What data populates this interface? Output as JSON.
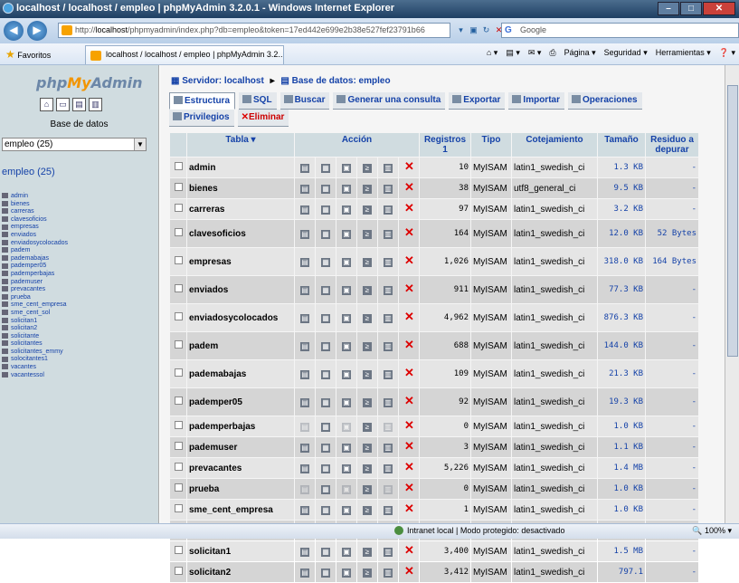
{
  "window": {
    "title": "localhost / localhost / empleo | phpMyAdmin 3.2.0.1 - Windows Internet Explorer"
  },
  "browser": {
    "url_prefix": "http://",
    "url_host": "localhost",
    "url_rest": "/phpmyadmin/index.php?db=empleo&token=17ed442e699e2b38e527fef23791b66",
    "search_placeholder": "Google",
    "favorites_label": "Favoritos",
    "tab_title": "localhost / localhost / empleo | phpMyAdmin 3.2...",
    "commands": [
      "Página ▾",
      "Seguridad ▾",
      "Herramientas ▾"
    ],
    "status_zone": "Intranet local | Modo protegido: desactivado",
    "zoom": "100%"
  },
  "left": {
    "logo_php": "php",
    "logo_my": "My",
    "logo_admin": "Admin",
    "db_label": "Base de datos",
    "db_select": "empleo (25)",
    "db_name": "empleo",
    "db_count": " (25)",
    "tables": [
      "admin",
      "bienes",
      "carreras",
      "clavesoficios",
      "empresas",
      "enviados",
      "enviadosycolocados",
      "padem",
      "pademabajas",
      "pademper05",
      "pademperbajas",
      "pademuser",
      "prevacantes",
      "prueba",
      "sme_cent_empresa",
      "sme_cent_sol",
      "solicitan1",
      "solicitan2",
      "solicitante",
      "solicitantes",
      "solicitantes_emmy",
      "solocitantes1",
      "vacantes",
      "vacantessol"
    ]
  },
  "breadcrumb": {
    "server": "Servidor: localhost",
    "db": "Base de datos: empleo"
  },
  "tabs": {
    "row1": [
      "Estructura",
      "SQL",
      "Buscar",
      "Generar una consulta",
      "Exportar",
      "Importar",
      "Operaciones"
    ],
    "row2": [
      "Privilegios",
      "Eliminar"
    ]
  },
  "table": {
    "headers": {
      "tabla": "Tabla ▾",
      "accion": "Acción",
      "registros": "Registros",
      "registros_sub": "1",
      "tipo": "Tipo",
      "cotejamiento": "Cotejamiento",
      "tamano": "Tamaño",
      "residuo": "Residuo a depurar"
    },
    "rows": [
      {
        "name": "admin",
        "records": "10",
        "type": "MyISAM",
        "collation": "latin1_swedish_ci",
        "size": "1.3 KB",
        "overhead": "-"
      },
      {
        "name": "bienes",
        "records": "38",
        "type": "MyISAM",
        "collation": "utf8_general_ci",
        "size": "9.5 KB",
        "overhead": "-"
      },
      {
        "name": "carreras",
        "records": "97",
        "type": "MyISAM",
        "collation": "latin1_swedish_ci",
        "size": "3.2 KB",
        "overhead": "-"
      },
      {
        "name": "clavesoficios",
        "records": "164",
        "type": "MyISAM",
        "collation": "latin1_swedish_ci",
        "size": "12.0 KB",
        "overhead": "52 Bytes"
      },
      {
        "name": "empresas",
        "records": "1,026",
        "type": "MyISAM",
        "collation": "latin1_swedish_ci",
        "size": "318.0 KB",
        "overhead": "164 Bytes"
      },
      {
        "name": "enviados",
        "records": "911",
        "type": "MyISAM",
        "collation": "latin1_swedish_ci",
        "size": "77.3 KB",
        "overhead": "-"
      },
      {
        "name": "enviadosycolocados",
        "records": "4,962",
        "type": "MyISAM",
        "collation": "latin1_swedish_ci",
        "size": "876.3 KB",
        "overhead": "-"
      },
      {
        "name": "padem",
        "records": "688",
        "type": "MyISAM",
        "collation": "latin1_swedish_ci",
        "size": "144.0 KB",
        "overhead": "-"
      },
      {
        "name": "pademabajas",
        "records": "109",
        "type": "MyISAM",
        "collation": "latin1_swedish_ci",
        "size": "21.3 KB",
        "overhead": "-"
      },
      {
        "name": "pademper05",
        "records": "92",
        "type": "MyISAM",
        "collation": "latin1_swedish_ci",
        "size": "19.3 KB",
        "overhead": "-"
      },
      {
        "name": "pademperbajas",
        "records": "0",
        "type": "MyISAM",
        "collation": "latin1_swedish_ci",
        "size": "1.0 KB",
        "overhead": "-"
      },
      {
        "name": "pademuser",
        "records": "3",
        "type": "MyISAM",
        "collation": "latin1_swedish_ci",
        "size": "1.1 KB",
        "overhead": "-"
      },
      {
        "name": "prevacantes",
        "records": "5,226",
        "type": "MyISAM",
        "collation": "latin1_swedish_ci",
        "size": "1.4 MB",
        "overhead": "-"
      },
      {
        "name": "prueba",
        "records": "0",
        "type": "MyISAM",
        "collation": "latin1_swedish_ci",
        "size": "1.0 KB",
        "overhead": "-"
      },
      {
        "name": "sme_cent_empresa",
        "records": "1",
        "type": "MyISAM",
        "collation": "latin1_swedish_ci",
        "size": "1.0 KB",
        "overhead": "-"
      },
      {
        "name": "sme_cent_sol",
        "records": "1",
        "type": "MyISAM",
        "collation": "latin1_swedish_ci",
        "size": "2.0 KB",
        "overhead": "-"
      },
      {
        "name": "solicitan1",
        "records": "3,400",
        "type": "MyISAM",
        "collation": "latin1_swedish_ci",
        "size": "1.5 MB",
        "overhead": "-"
      },
      {
        "name": "solicitan2",
        "records": "3,412",
        "type": "MyISAM",
        "collation": "latin1_swedish_ci",
        "size": "797.1",
        "overhead": "-"
      }
    ]
  },
  "colors": {
    "link": "#1542a8",
    "delete": "#dd0000",
    "header_bg": "#d0dce0"
  }
}
